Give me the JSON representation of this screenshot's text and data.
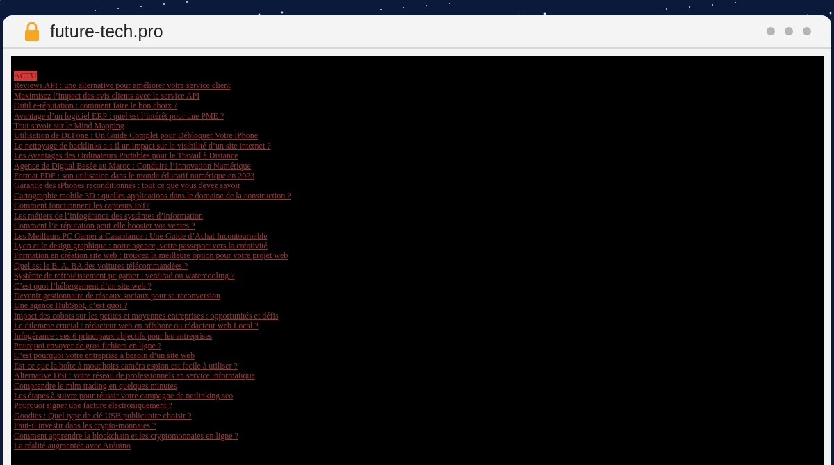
{
  "browser": {
    "address": "future-tech.pro"
  },
  "page": {
    "category": "ACTU",
    "links": [
      "Reviews API : une alternative pour améliorer votre service client",
      "Maximisez l’impact des avis clients avec le service API",
      "Outil e-réputation : comment faire le bon choix ?",
      "Avantage d’un logiciel ERP : quel est l’intérêt pour une PME ?",
      "Tout savoir sur le Mind Mapping",
      "Utilisation de Dr.Fone : Un Guide Complet pour Débloquer Votre iPhone",
      "Le nettoyage de backlinks a-t-il un impact sur la visibilité d’un site internet ?",
      "Les Avantages des Ordinateurs Portables pour le Travail à Distance",
      "Agence de Digital Basée au Maroc : Conduire l’Innovation Numérique",
      "Format PDF : son utilisation dans le monde éducatif numérique en 2023",
      "Garantie des iPhones reconditionnés : tout ce que vous devez savoir",
      "Cartographie mobile 3D : quelles applications dans le domaine de la construction ?",
      "Comment fonctionnent les capteurs IoT?",
      "Les métiers de l’infogérance des systèmes d’information",
      "Comment l’e-réputation peut-elle booster vos ventes ?",
      "Les Meilleurs PC Gamer à Casablanca : Une Guide d’Achat Incontournable",
      "Lyon et le design graphique : notre agence, votre passeport vers la créativité",
      "Formation en création site web : trouvez la meilleure option pour votre projet web",
      "Quel est le B. A. BA des voitures télécommandées ?",
      "Système de refroidissement pc gamer : ventirad ou watercooling ?",
      "C’est quoi l’hébergement d’un site web ?",
      "Devenir gestionnaire de réseaux sociaux pour sa reconversion",
      "Une agence HubSpot, c’est quoi ?",
      "Impact des cobots sur les petites et moyennes entreprises : opportunités et défis",
      "Le dilemme crucial : rédacteur web en offshore ou rédacteur web Local ?",
      "Infogérance : ses 6 principaux objectifs pour les entreprises",
      "Pourquoi envoyer de gros fichiers en ligne ?",
      "C’est pourquoi votre entreprise a besoin d’un site web",
      "Est-ce que la boîte à mouchoirs caméra espion est facile à utiliser ?",
      "Alternative DSI : votre réseau de professionnels en service informatique",
      "Comprendre le mlm trading en quelques minutes",
      "Les étapes à suivre pour réussir votre campagne de netlinking seo",
      "Pourquoi signer une facture électroniquement ?",
      "Goodies : Quel type de clé USB publicitaire choisir ?",
      "Faut-il investir dans les crypto-monnaies ?",
      "Comment apprendre la blockchain et les cryptomonnaies en ligne ?",
      "La réalité augmentée avec Arduino"
    ]
  }
}
